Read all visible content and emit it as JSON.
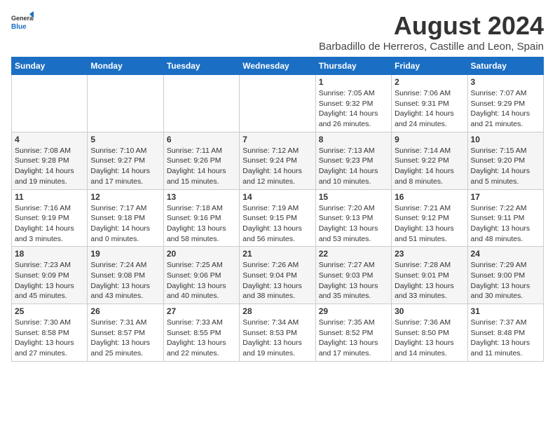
{
  "logo": {
    "text_general": "General",
    "text_blue": "Blue"
  },
  "title": "August 2024",
  "subtitle": "Barbadillo de Herreros, Castille and Leon, Spain",
  "days_of_week": [
    "Sunday",
    "Monday",
    "Tuesday",
    "Wednesday",
    "Thursday",
    "Friday",
    "Saturday"
  ],
  "weeks": [
    [
      {
        "day": "",
        "info": ""
      },
      {
        "day": "",
        "info": ""
      },
      {
        "day": "",
        "info": ""
      },
      {
        "day": "",
        "info": ""
      },
      {
        "day": "1",
        "info": "Sunrise: 7:05 AM\nSunset: 9:32 PM\nDaylight: 14 hours\nand 26 minutes."
      },
      {
        "day": "2",
        "info": "Sunrise: 7:06 AM\nSunset: 9:31 PM\nDaylight: 14 hours\nand 24 minutes."
      },
      {
        "day": "3",
        "info": "Sunrise: 7:07 AM\nSunset: 9:29 PM\nDaylight: 14 hours\nand 21 minutes."
      }
    ],
    [
      {
        "day": "4",
        "info": "Sunrise: 7:08 AM\nSunset: 9:28 PM\nDaylight: 14 hours\nand 19 minutes."
      },
      {
        "day": "5",
        "info": "Sunrise: 7:10 AM\nSunset: 9:27 PM\nDaylight: 14 hours\nand 17 minutes."
      },
      {
        "day": "6",
        "info": "Sunrise: 7:11 AM\nSunset: 9:26 PM\nDaylight: 14 hours\nand 15 minutes."
      },
      {
        "day": "7",
        "info": "Sunrise: 7:12 AM\nSunset: 9:24 PM\nDaylight: 14 hours\nand 12 minutes."
      },
      {
        "day": "8",
        "info": "Sunrise: 7:13 AM\nSunset: 9:23 PM\nDaylight: 14 hours\nand 10 minutes."
      },
      {
        "day": "9",
        "info": "Sunrise: 7:14 AM\nSunset: 9:22 PM\nDaylight: 14 hours\nand 8 minutes."
      },
      {
        "day": "10",
        "info": "Sunrise: 7:15 AM\nSunset: 9:20 PM\nDaylight: 14 hours\nand 5 minutes."
      }
    ],
    [
      {
        "day": "11",
        "info": "Sunrise: 7:16 AM\nSunset: 9:19 PM\nDaylight: 14 hours\nand 3 minutes."
      },
      {
        "day": "12",
        "info": "Sunrise: 7:17 AM\nSunset: 9:18 PM\nDaylight: 14 hours\nand 0 minutes."
      },
      {
        "day": "13",
        "info": "Sunrise: 7:18 AM\nSunset: 9:16 PM\nDaylight: 13 hours\nand 58 minutes."
      },
      {
        "day": "14",
        "info": "Sunrise: 7:19 AM\nSunset: 9:15 PM\nDaylight: 13 hours\nand 56 minutes."
      },
      {
        "day": "15",
        "info": "Sunrise: 7:20 AM\nSunset: 9:13 PM\nDaylight: 13 hours\nand 53 minutes."
      },
      {
        "day": "16",
        "info": "Sunrise: 7:21 AM\nSunset: 9:12 PM\nDaylight: 13 hours\nand 51 minutes."
      },
      {
        "day": "17",
        "info": "Sunrise: 7:22 AM\nSunset: 9:11 PM\nDaylight: 13 hours\nand 48 minutes."
      }
    ],
    [
      {
        "day": "18",
        "info": "Sunrise: 7:23 AM\nSunset: 9:09 PM\nDaylight: 13 hours\nand 45 minutes."
      },
      {
        "day": "19",
        "info": "Sunrise: 7:24 AM\nSunset: 9:08 PM\nDaylight: 13 hours\nand 43 minutes."
      },
      {
        "day": "20",
        "info": "Sunrise: 7:25 AM\nSunset: 9:06 PM\nDaylight: 13 hours\nand 40 minutes."
      },
      {
        "day": "21",
        "info": "Sunrise: 7:26 AM\nSunset: 9:04 PM\nDaylight: 13 hours\nand 38 minutes."
      },
      {
        "day": "22",
        "info": "Sunrise: 7:27 AM\nSunset: 9:03 PM\nDaylight: 13 hours\nand 35 minutes."
      },
      {
        "day": "23",
        "info": "Sunrise: 7:28 AM\nSunset: 9:01 PM\nDaylight: 13 hours\nand 33 minutes."
      },
      {
        "day": "24",
        "info": "Sunrise: 7:29 AM\nSunset: 9:00 PM\nDaylight: 13 hours\nand 30 minutes."
      }
    ],
    [
      {
        "day": "25",
        "info": "Sunrise: 7:30 AM\nSunset: 8:58 PM\nDaylight: 13 hours\nand 27 minutes."
      },
      {
        "day": "26",
        "info": "Sunrise: 7:31 AM\nSunset: 8:57 PM\nDaylight: 13 hours\nand 25 minutes."
      },
      {
        "day": "27",
        "info": "Sunrise: 7:33 AM\nSunset: 8:55 PM\nDaylight: 13 hours\nand 22 minutes."
      },
      {
        "day": "28",
        "info": "Sunrise: 7:34 AM\nSunset: 8:53 PM\nDaylight: 13 hours\nand 19 minutes."
      },
      {
        "day": "29",
        "info": "Sunrise: 7:35 AM\nSunset: 8:52 PM\nDaylight: 13 hours\nand 17 minutes."
      },
      {
        "day": "30",
        "info": "Sunrise: 7:36 AM\nSunset: 8:50 PM\nDaylight: 13 hours\nand 14 minutes."
      },
      {
        "day": "31",
        "info": "Sunrise: 7:37 AM\nSunset: 8:48 PM\nDaylight: 13 hours\nand 11 minutes."
      }
    ]
  ]
}
